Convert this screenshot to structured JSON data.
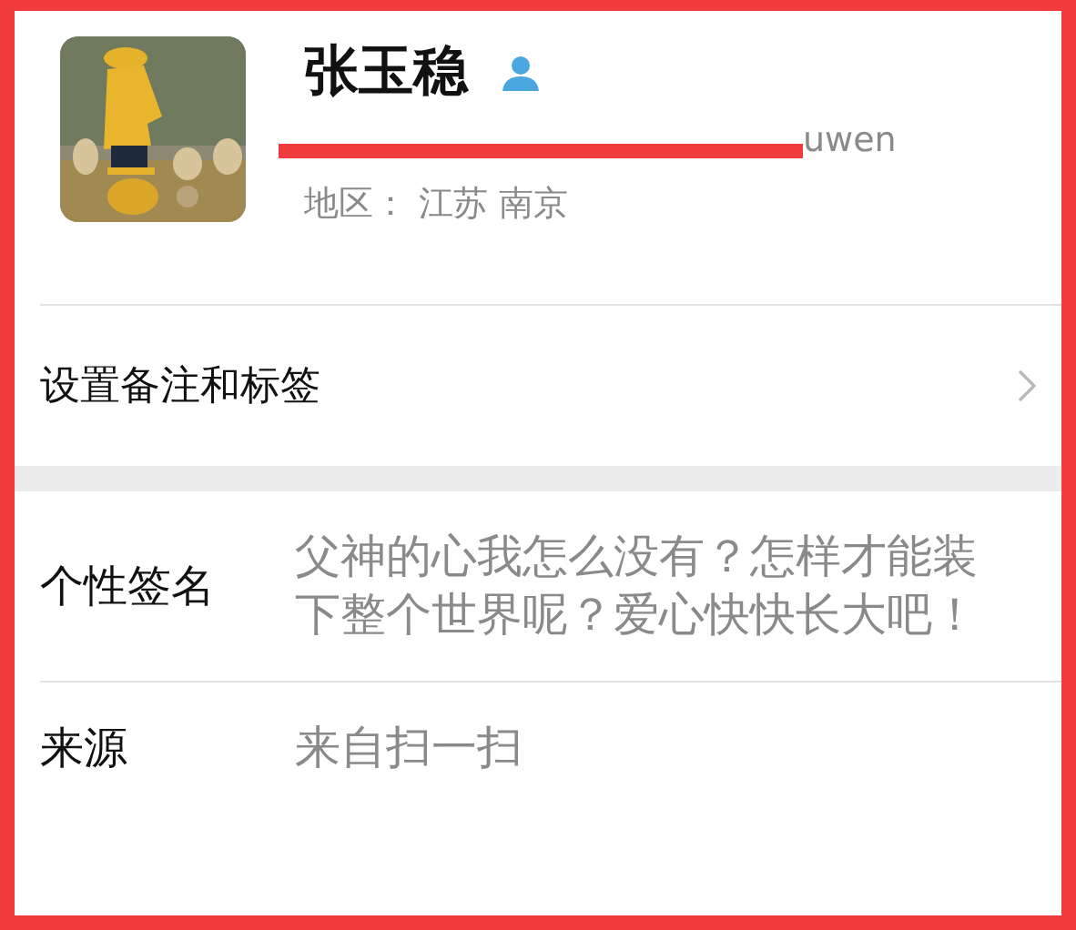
{
  "profile": {
    "name": "张玉稳",
    "wechat_id": "uwen",
    "region": "地区：  江苏 南京",
    "id_redacted": true
  },
  "menu_row": {
    "label": "设置备注和标签"
  },
  "details": [
    {
      "label": "个性签名",
      "value": "父神的心我怎么没有？怎样才能装下整个世界呢？爱心快快长大吧！"
    },
    {
      "label": "来源",
      "value": "来自扫一扫"
    }
  ]
}
